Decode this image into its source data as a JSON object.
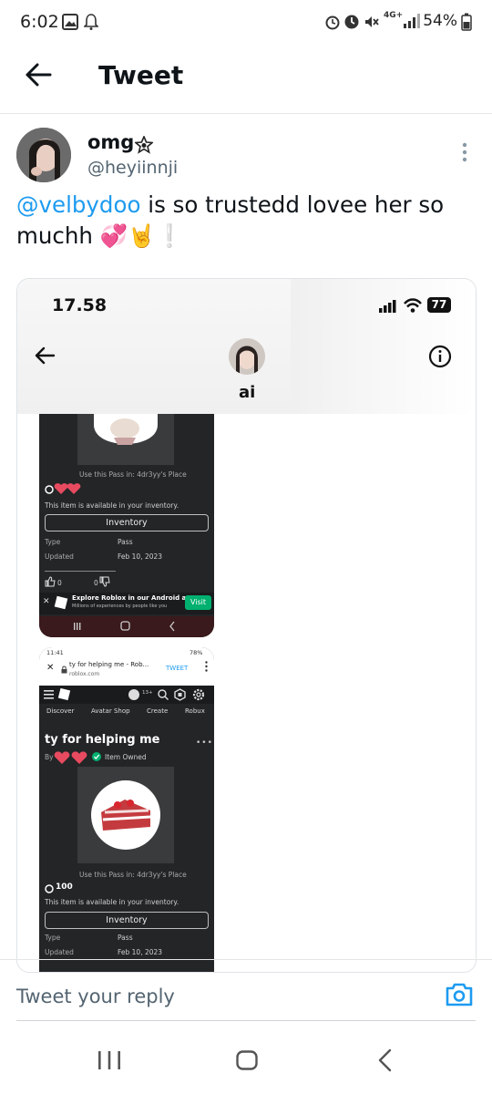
{
  "status_bar": {
    "time": "6:02",
    "network": "4G+",
    "battery": "54%"
  },
  "header": {
    "title": "Tweet"
  },
  "tweet": {
    "author_name": "omg",
    "author_handle": "@heyiinnji",
    "mention": "@velbydoo",
    "text_line1_rest": " is so trustedd lovee her so",
    "text_line2": "muchh 💞🤘❕"
  },
  "embedded": {
    "ios_time": "17.58",
    "ios_battery": "77",
    "contact_name": "ai",
    "shot1": {
      "use_pass": "Use this Pass in: 4dr3yy's Place",
      "available": "This item is available in your inventory.",
      "inventory": "Inventory",
      "type_label": "Type",
      "type_value": "Pass",
      "updated_label": "Updated",
      "updated_value": "Feb 10, 2023",
      "like_count": "0",
      "dislike_count": "0",
      "banner_title": "Explore Roblox in our Android app!",
      "banner_sub": "Millions of experiences by people like you",
      "banner_button": "Visit"
    },
    "shot2": {
      "status_time": "11:41",
      "status_battery": "78%",
      "tab_title": "ty for helping me - Rob...",
      "tab_url": "roblox.com",
      "tweet_button": "TWEET",
      "age_badge": "13+",
      "nav": [
        "Discover",
        "Avatar Shop",
        "Create",
        "Robux"
      ],
      "item_title": "ty for helping me",
      "by": "By",
      "owned": "Item Owned",
      "use_pass": "Use this Pass in: 4dr3yy's Place",
      "price": "100",
      "available": "This item is available in your inventory.",
      "inventory": "Inventory",
      "type_label": "Type",
      "type_value": "Pass",
      "updated_label": "Updated",
      "updated_value": "Feb 10, 2023"
    }
  },
  "reply": {
    "placeholder": "Tweet your reply"
  },
  "colors": {
    "accent": "#1d9bf0",
    "roblox_dark": "#232527",
    "visit_green": "#00b06f"
  }
}
